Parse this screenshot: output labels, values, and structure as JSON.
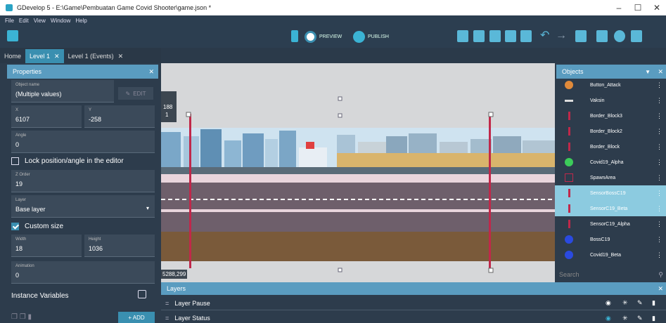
{
  "window": {
    "title": "GDevelop 5 - E:\\Game\\Pembuatan Game Covid Shooter\\game.json *",
    "min": "–",
    "restore": "☐",
    "close": "✕"
  },
  "menu": [
    "File",
    "Edit",
    "View",
    "Window",
    "Help"
  ],
  "toolbar": {
    "preview": "PREVIEW",
    "publish": "PUBLISH"
  },
  "tabs": [
    {
      "label": "Home"
    },
    {
      "label": "Level 1",
      "close": "✕"
    },
    {
      "label": "Level 1 (Events)",
      "close": "✕"
    }
  ],
  "properties": {
    "title": "Properties",
    "close": "✕",
    "object_name_label": "Object name",
    "object_name": "(Multiple values)",
    "edit": "EDIT",
    "x_label": "X",
    "x": "6107",
    "y_label": "Y",
    "y": "-258",
    "angle_label": "Angle",
    "angle": "0",
    "lock_label": "Lock position/angle in the editor",
    "z_label": "Z Order",
    "z": "19",
    "layer_label": "Layer",
    "layer": "Base layer",
    "custom_size_label": "Custom size",
    "width_label": "Width",
    "width": "18",
    "height_label": "Height",
    "height": "1036",
    "animation_label": "Animation",
    "animation": "0",
    "instance_vars": "Instance Variables",
    "add": "+ ADD"
  },
  "canvas": {
    "coord_top": "188",
    "coord_top2": "1",
    "coord_bottom": "5288,299"
  },
  "objects": {
    "title": "Objects",
    "search_placeholder": "Search",
    "items": [
      {
        "name": "Button_Attack",
        "selected": false,
        "icon": "sword-icon",
        "color": "#e08a3a"
      },
      {
        "name": "Vaksin",
        "selected": false,
        "icon": "vaccine-icon",
        "color": "#dddddd"
      },
      {
        "name": "Border_Block3",
        "selected": false,
        "icon": "border-icon",
        "color": "#c0284a"
      },
      {
        "name": "Border_Block2",
        "selected": false,
        "icon": "border-icon",
        "color": "#c0284a"
      },
      {
        "name": "Border_Block",
        "selected": false,
        "icon": "border-icon",
        "color": "#c0284a"
      },
      {
        "name": "Covid19_Alpha",
        "selected": false,
        "icon": "virus-icon",
        "color": "#3ccc5a"
      },
      {
        "name": "SpawnArea",
        "selected": false,
        "icon": "spawn-icon",
        "color": "#c0284a"
      },
      {
        "name": "SensorBossC19",
        "selected": true,
        "icon": "sensor-icon",
        "color": "#c0284a"
      },
      {
        "name": "SensorC19_Beta",
        "selected": true,
        "icon": "sensor-icon",
        "color": "#c0284a"
      },
      {
        "name": "SensorC19_Alpha",
        "selected": false,
        "icon": "sensor-icon",
        "color": "#c0284a"
      },
      {
        "name": "BossC19",
        "selected": false,
        "icon": "boss-icon",
        "color": "#2a4ae0"
      },
      {
        "name": "Covid19_Beta",
        "selected": false,
        "icon": "virus-icon",
        "color": "#2a4ae0"
      }
    ]
  },
  "layers": {
    "title": "Layers",
    "close": "✕",
    "items": [
      {
        "name": "Layer Pause"
      },
      {
        "name": "Layer Status"
      }
    ]
  },
  "colors": {
    "accent": "#3a8fb0",
    "panel": "#2d3c4c",
    "selected": "#8ccbe0",
    "sensor": "#c0284a"
  }
}
